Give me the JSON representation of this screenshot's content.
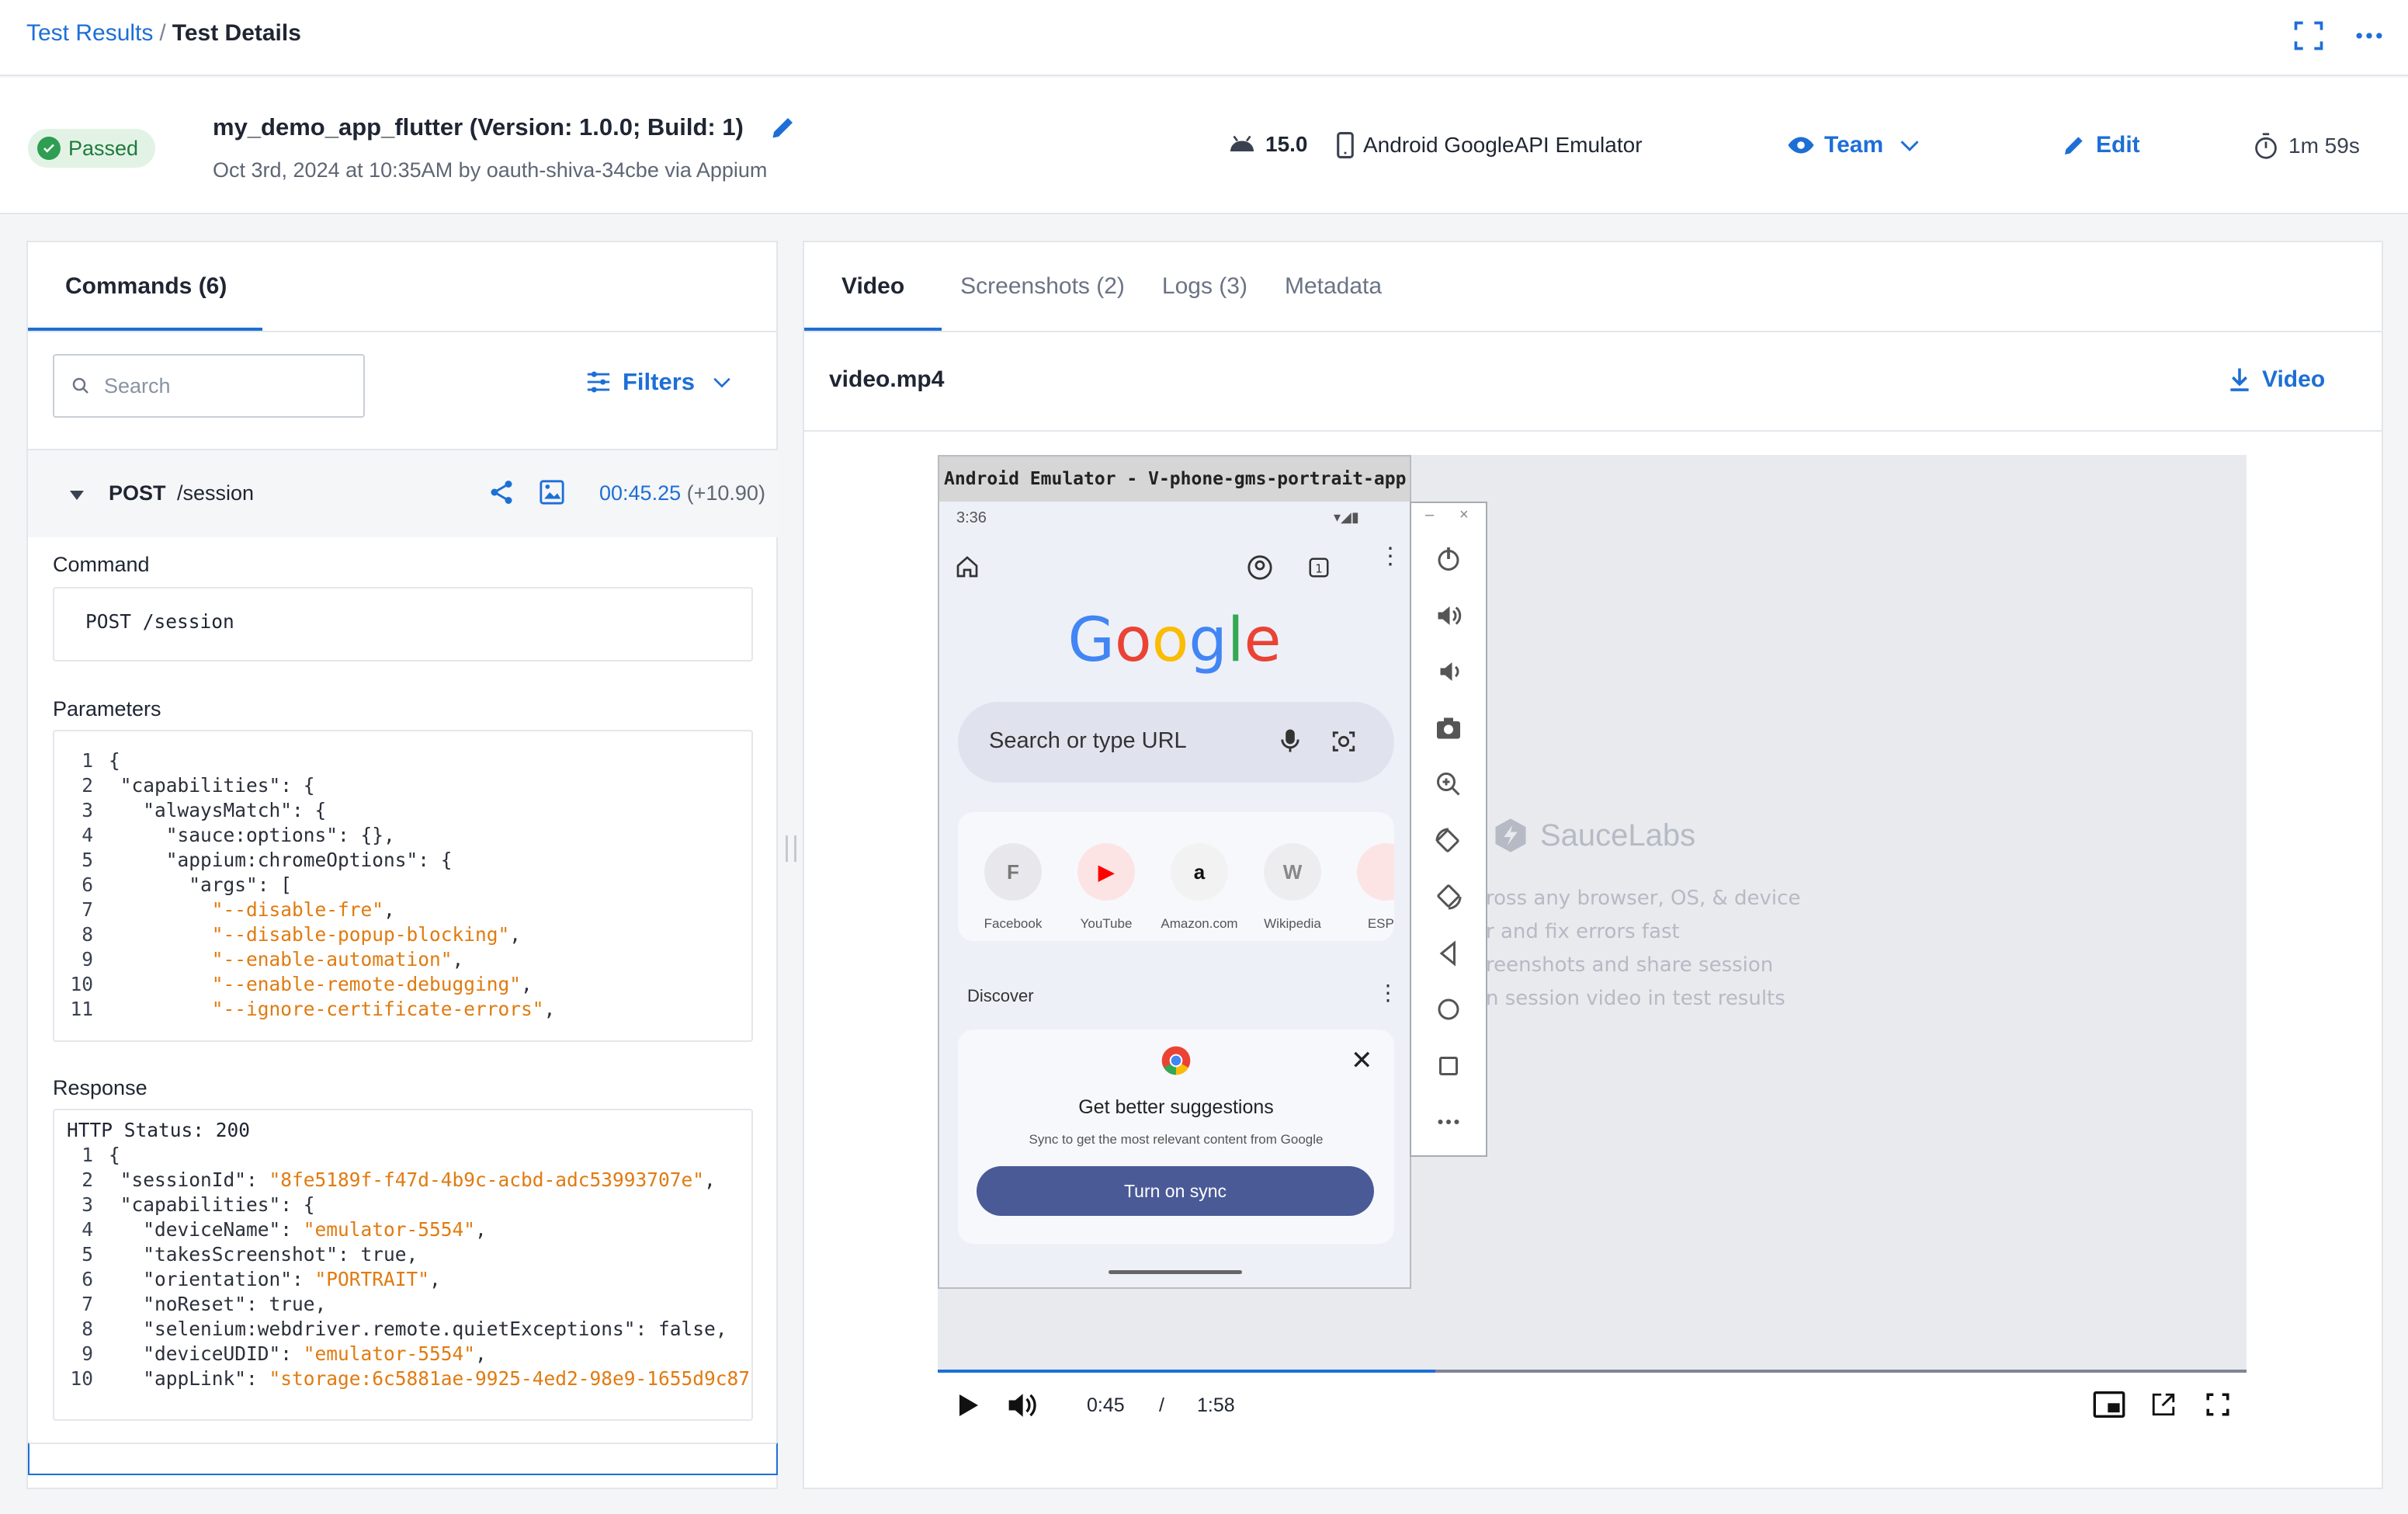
{
  "breadcrumb": {
    "link": "Test Results",
    "separator": "/",
    "current": "Test Details"
  },
  "header": {
    "status": "Passed",
    "test_name": "my_demo_app_flutter (Version: 1.0.0; Build: 1)",
    "meta": "Oct 3rd, 2024 at 10:35AM by oauth-shiva-34cbe via Appium",
    "os_version": "15.0",
    "device": "Android GoogleAPI Emulator",
    "visibility": "Team",
    "edit": "Edit",
    "duration": "1m 59s"
  },
  "left": {
    "tab": "Commands (6)",
    "search_placeholder": "Search",
    "filters": "Filters",
    "command": {
      "method": "POST",
      "path": "/session",
      "time": "00:45.25",
      "delta": "(+10.90)"
    },
    "command_label": "Command",
    "command_value": "POST /session",
    "params_label": "Parameters",
    "response_label": "Response",
    "http_status": "HTTP Status: 200"
  },
  "params_lines": [
    {
      "n": "1",
      "k": "{",
      "s": "",
      "e": ""
    },
    {
      "n": "2",
      "k": " \"capabilities\": {",
      "s": "",
      "e": ""
    },
    {
      "n": "3",
      "k": "   \"alwaysMatch\": {",
      "s": "",
      "e": ""
    },
    {
      "n": "4",
      "k": "     \"sauce:options\": {},",
      "s": "",
      "e": ""
    },
    {
      "n": "5",
      "k": "     \"appium:chromeOptions\": {",
      "s": "",
      "e": ""
    },
    {
      "n": "6",
      "k": "       \"args\": [",
      "s": "",
      "e": ""
    },
    {
      "n": "7",
      "k": "         ",
      "s": "\"--disable-fre\"",
      "e": ","
    },
    {
      "n": "8",
      "k": "         ",
      "s": "\"--disable-popup-blocking\"",
      "e": ","
    },
    {
      "n": "9",
      "k": "         ",
      "s": "\"--enable-automation\"",
      "e": ","
    },
    {
      "n": "10",
      "k": "         ",
      "s": "\"--enable-remote-debugging\"",
      "e": ","
    },
    {
      "n": "11",
      "k": "         ",
      "s": "\"--ignore-certificate-errors\"",
      "e": ","
    }
  ],
  "response_lines": [
    {
      "n": "1",
      "k": "{",
      "s": "",
      "e": ""
    },
    {
      "n": "2",
      "k": " \"sessionId\": ",
      "s": "\"8fe5189f-f47d-4b9c-acbd-adc53993707e\"",
      "e": ","
    },
    {
      "n": "3",
      "k": " \"capabilities\": {",
      "s": "",
      "e": ""
    },
    {
      "n": "4",
      "k": "   \"deviceName\": ",
      "s": "\"emulator-5554\"",
      "e": ","
    },
    {
      "n": "5",
      "k": "   \"takesScreenshot\": true,",
      "s": "",
      "e": ""
    },
    {
      "n": "6",
      "k": "   \"orientation\": ",
      "s": "\"PORTRAIT\"",
      "e": ","
    },
    {
      "n": "7",
      "k": "   \"noReset\": true,",
      "s": "",
      "e": ""
    },
    {
      "n": "8",
      "k": "   \"selenium:webdriver.remote.quietExceptions\": false,",
      "s": "",
      "e": ""
    },
    {
      "n": "9",
      "k": "   \"deviceUDID\": ",
      "s": "\"emulator-5554\"",
      "e": ","
    },
    {
      "n": "10",
      "k": "   \"appLink\": ",
      "s": "\"storage:6c5881ae-9925-4ed2-98e9-1655d9c87",
      "e": ""
    }
  ],
  "right": {
    "tabs": [
      "Video",
      "Screenshots (2)",
      "Logs (3)",
      "Metadata"
    ],
    "file": "video.mp4",
    "download": "Video",
    "time_current": "0:45",
    "time_sep": "/",
    "time_total": "1:58",
    "progress": 0.38
  },
  "emulator": {
    "title": "Android Emulator - V-phone-gms-portrait-app...",
    "clock": "3:36",
    "search": "Search or type URL",
    "shortcuts": [
      "Facebook",
      "YouTube",
      "Amazon.com",
      "Wikipedia",
      "ESPN"
    ],
    "discover": "Discover",
    "card_title": "Get better suggestions",
    "card_sub": "Sync to get the most relevant content from Google",
    "sync_button": "Turn on sync",
    "logo": "Google"
  },
  "watermark": {
    "brand": "SauceLabs",
    "lines": [
      "ross any browser, OS, & device",
      "r and fix errors fast",
      "reenshots and share session",
      "n session video in test results"
    ]
  },
  "colors": {
    "accent": "#1d6fd6",
    "pass": "#2e9e52",
    "string": "#e07b10",
    "sync": "#4a5a96"
  }
}
